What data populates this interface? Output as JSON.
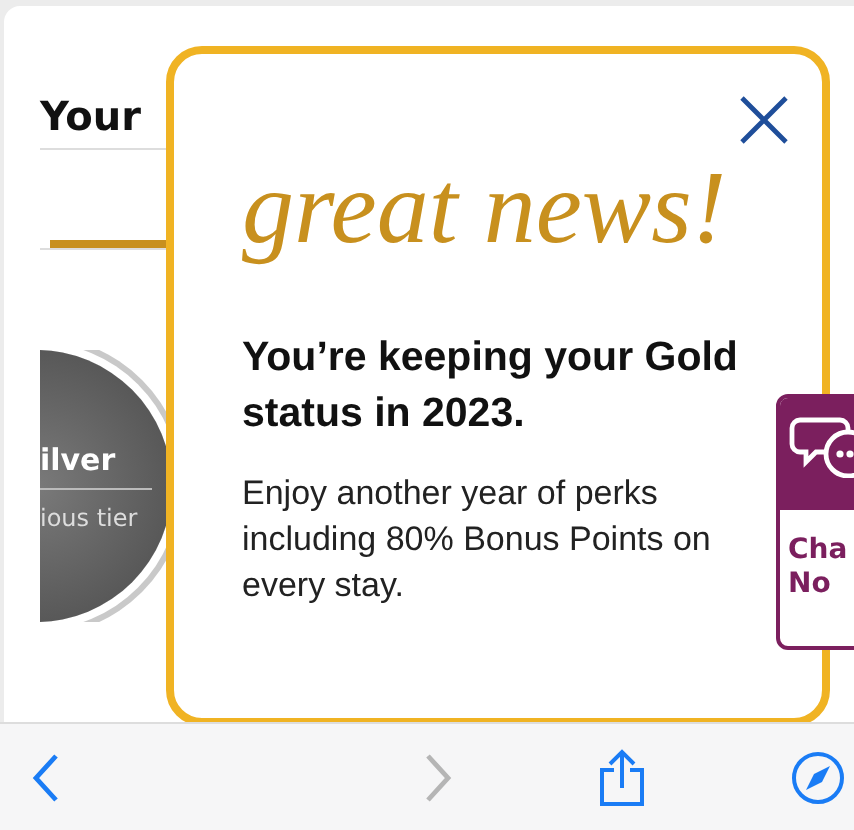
{
  "page": {
    "heading": "Your",
    "tier_badge": {
      "title": "ilver",
      "subtitle": "ious tier"
    }
  },
  "modal": {
    "headline": "great news!",
    "title": "You’re keeping your Gold status in 2023.",
    "body": "Enjoy another year of perks including 80% Bonus Points on every stay."
  },
  "chat_widget": {
    "line_1": "Cha",
    "line_2": "No"
  },
  "toolbar": [
    {
      "kind": "back",
      "disabled": false
    },
    {
      "kind": "forward",
      "disabled": true
    },
    {
      "kind": "share",
      "disabled": false
    },
    {
      "kind": "compass",
      "disabled": false
    }
  ]
}
